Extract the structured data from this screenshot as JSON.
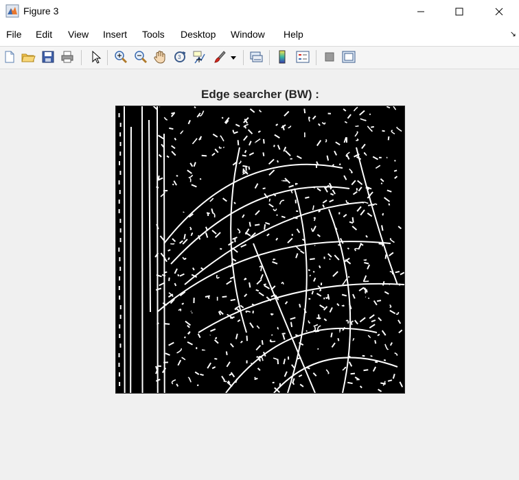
{
  "window": {
    "title": "Figure 3"
  },
  "menu": {
    "items": [
      "File",
      "Edit",
      "View",
      "Insert",
      "Tools",
      "Desktop",
      "Window",
      "Help"
    ]
  },
  "toolbar": {
    "buttons": [
      "new-figure-icon",
      "open-file-icon",
      "save-icon",
      "print-icon",
      "select-arrow-icon",
      "zoom-in-icon",
      "zoom-out-icon",
      "pan-hand-icon",
      "rotate-3d-icon",
      "data-cursor-icon",
      "brush-icon",
      "brush-dropdown-icon",
      "link-plot-icon",
      "colorbar-icon",
      "legend-icon",
      "hide-plot-tools-icon",
      "show-plot-tools-icon"
    ]
  },
  "figure": {
    "axes_title": "Edge searcher (BW) :",
    "image_description": "binary edge map, white edges on black"
  },
  "colors": {
    "figure_bg": "#f0f0f0",
    "image_bg": "#000000",
    "edge": "#ffffff"
  }
}
